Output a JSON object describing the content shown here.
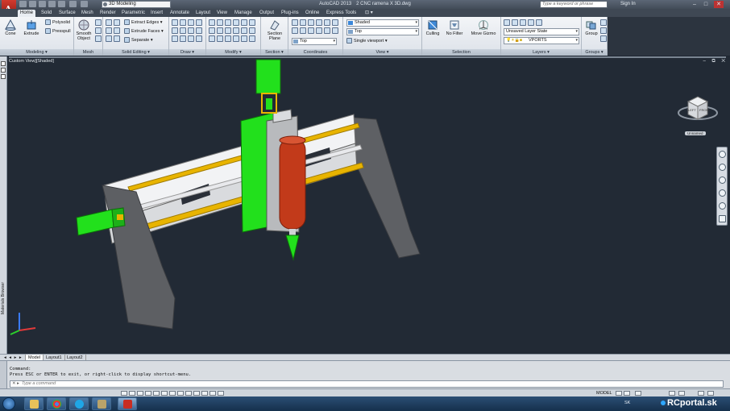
{
  "titlebar": {
    "workspace": "3D Modeling",
    "app_name": "AutoCAD 2013",
    "filename": "2 CNC ramena X 3D.dwg",
    "search_placeholder": "Type a keyword or phrase",
    "signin": "Sign In",
    "minimize": "–",
    "maximize": "□",
    "close": "✕"
  },
  "tabs": [
    "Home",
    "Solid",
    "Surface",
    "Mesh",
    "Render",
    "Parametric",
    "Insert",
    "Annotate",
    "Layout",
    "View",
    "Manage",
    "Output",
    "Plug-ins",
    "Online",
    "Express Tools",
    "⊡ ▾"
  ],
  "ribbon": {
    "modeling": {
      "label": "Modeling ▾",
      "cone": "Cone",
      "extrude": "Extrude",
      "polysolid": "Polysolid",
      "presspull": "Presspull"
    },
    "mesh": {
      "label": "Mesh",
      "smooth": "Smooth",
      "object": "Object"
    },
    "solid_editing": {
      "label": "Solid Editing ▾",
      "extract": "Extract Edges ▾",
      "extrude_faces": "Extrude Faces ▾",
      "separate": "Separate ▾"
    },
    "draw": {
      "label": "Draw ▾"
    },
    "modify": {
      "label": "Modify ▾"
    },
    "section": {
      "label": "Section ▾",
      "section_plane": "Section",
      "plane": "Plane"
    },
    "coordinates": {
      "label": "Coordinates",
      "world": "World",
      "top": "Top"
    },
    "view": {
      "label": "View ▾",
      "visual_style": "Shaded",
      "view_dir": "Top",
      "viewport": "Single viewport ▾"
    },
    "selection": {
      "label": "Selection",
      "culling": "Culling",
      "no_filter": "No Filter",
      "move_gizmo": "Move Gizmo"
    },
    "layers": {
      "label": "Layers ▾",
      "layer_state": "Unsaved Layer State",
      "layer_name": "VPORTS"
    },
    "groups": {
      "label": "Groups ▾",
      "group": "Group"
    }
  },
  "viewport": {
    "label": "Custom View][Shaded]",
    "controls": "– ⧉ ✕",
    "viewcube_left": "LEFT",
    "viewcube_front": "FRONT",
    "ucs_name": "Unnamed",
    "materials_browser": "Materials Browser"
  },
  "layout_tabs": {
    "model": "Model",
    "layout1": "Layout1",
    "layout2": "Layout2",
    "nav": "◂ ◂ ▸ ▸"
  },
  "command": {
    "line1": "Command:",
    "line2": "Press ESC or ENTER to exit, or right-click to display shortcut-menu.",
    "placeholder": "Type a command"
  },
  "status": {
    "model": "MODEL"
  },
  "taskbar": {
    "lang": "SK",
    "watermark": "RCportal.sk"
  },
  "colors": {
    "green": "#22e01c",
    "red": "#c23a1a",
    "gray": "#6c6e72",
    "yellow": "#e8b400",
    "white": "#f1f2f4"
  }
}
